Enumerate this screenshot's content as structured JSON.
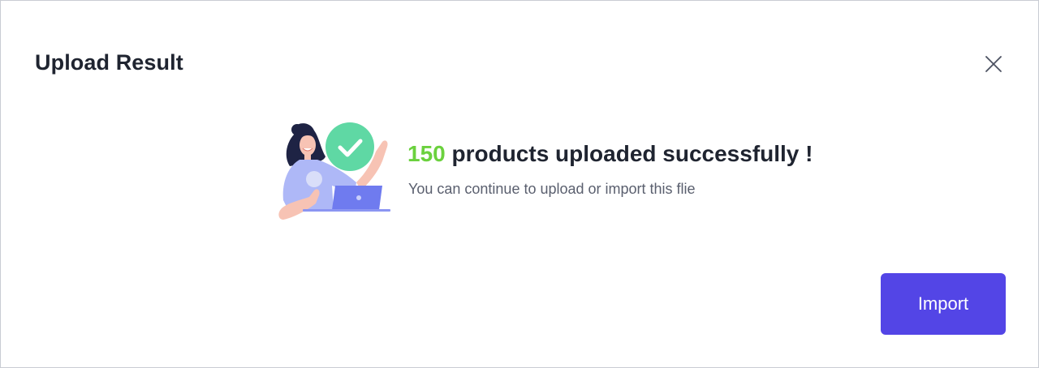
{
  "dialog": {
    "title": "Upload Result",
    "close_icon": "close-icon"
  },
  "result": {
    "count": "150",
    "headline_rest": "products uploaded successfully !",
    "subtext": "You can continue to upload or import this flie",
    "illustration_icon": "woman-laptop-success-illustration"
  },
  "actions": {
    "import_label": "Import"
  },
  "colors": {
    "accent": "#5345e6",
    "success": "#6bd13e",
    "check_circle": "#5fd8a4"
  }
}
